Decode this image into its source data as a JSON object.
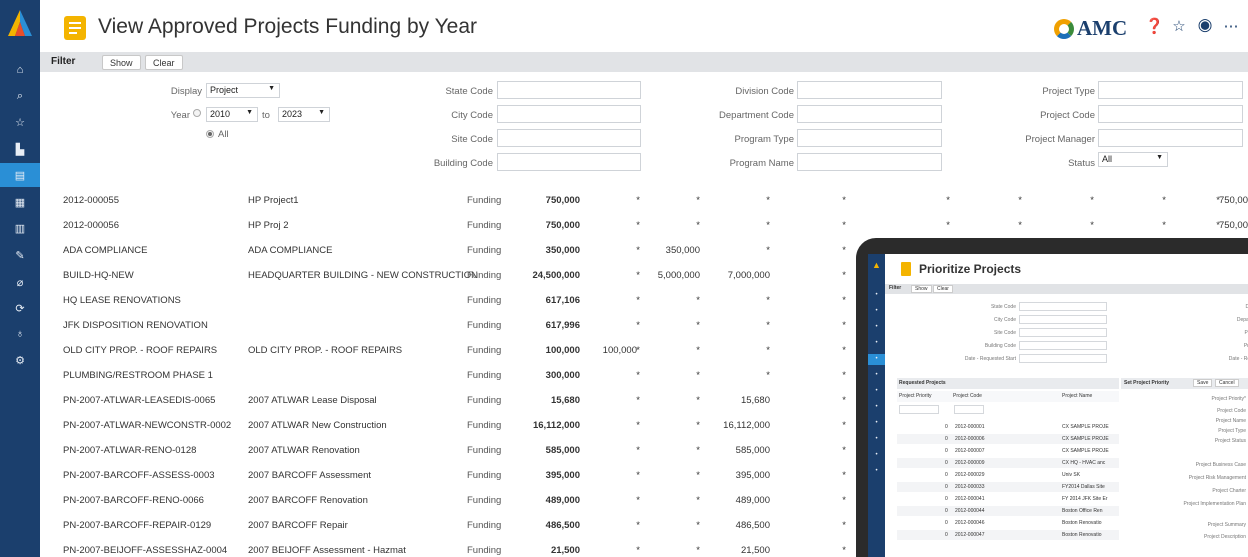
{
  "header": {
    "title": "View Approved Projects Funding by Year",
    "brand": "AMC"
  },
  "nav": {
    "rail_icons": [
      "home-icon",
      "search-icon",
      "star-icon",
      "building-chart-icon",
      "report-icon",
      "grid-icon",
      "document-icon",
      "wrench-icon",
      "tag-icon",
      "refresh-icon",
      "lightbulb-icon",
      "gear-icon"
    ],
    "active_index": 4
  },
  "filter_bar": {
    "label": "Filter",
    "show_label": "Show",
    "clear_label": "Clear"
  },
  "filters": {
    "display_label": "Display",
    "display_value": "Project",
    "year_label": "Year",
    "year_from": "2010",
    "to_label": "to",
    "year_to": "2023",
    "all_label": "All",
    "state_code": "State Code",
    "city_code": "City Code",
    "site_code": "Site Code",
    "building_code": "Building Code",
    "division_code": "Division Code",
    "department_code": "Department Code",
    "program_type": "Program Type",
    "program_name": "Program Name",
    "project_type": "Project Type",
    "project_code": "Project Code",
    "project_manager": "Project Manager",
    "status_label": "Status",
    "status_value": "All"
  },
  "rows": [
    {
      "code": "2012-000055",
      "name": "HP Project1",
      "type": "Funding",
      "total": "750,000",
      "y1": "*",
      "y2": "*",
      "y3": "*",
      "y4": "*",
      "y5": "*",
      "y6": "*",
      "y7": "*",
      "y8": "*",
      "y9": "*",
      "y10": "750,00"
    },
    {
      "code": "2012-000056",
      "name": "HP Proj 2",
      "type": "Funding",
      "total": "750,000",
      "y1": "*",
      "y2": "*",
      "y3": "*",
      "y4": "*",
      "y5": "*",
      "y6": "*",
      "y7": "*",
      "y8": "*",
      "y9": "*",
      "y10": "750,00"
    },
    {
      "code": "ADA COMPLIANCE",
      "name": "ADA COMPLIANCE",
      "type": "Funding",
      "total": "350,000",
      "y1": "*",
      "y2": "350,000",
      "y3": "*",
      "y4": "*"
    },
    {
      "code": "BUILD-HQ-NEW",
      "name": "HEADQUARTER BUILDING - NEW CONSTRUCTION",
      "type": "Funding",
      "total": "24,500,000",
      "y1": "*",
      "y2": "5,000,000",
      "y3": "7,000,000",
      "y4": "*"
    },
    {
      "code": "HQ LEASE RENOVATIONS",
      "name": "",
      "type": "Funding",
      "total": "617,106",
      "y1": "*",
      "y2": "*",
      "y3": "*",
      "y4": "*"
    },
    {
      "code": "JFK DISPOSITION RENOVATION",
      "name": "",
      "type": "Funding",
      "total": "617,996",
      "y1": "*",
      "y2": "*",
      "y3": "*",
      "y4": "*"
    },
    {
      "code": "OLD CITY PROP. - ROOF REPAIRS",
      "name": "OLD CITY PROP. - ROOF REPAIRS",
      "type": "Funding",
      "total": "100,000",
      "y0": "100,000",
      "y1": "*",
      "y2": "*",
      "y3": "*",
      "y4": "*"
    },
    {
      "code": "PLUMBING/RESTROOM PHASE 1",
      "name": "",
      "type": "Funding",
      "total": "300,000",
      "y1": "*",
      "y2": "*",
      "y3": "*",
      "y4": "*"
    },
    {
      "code": "PN-2007-ATLWAR-LEASEDIS-0065",
      "name": "2007 ATLWAR Lease Disposal",
      "type": "Funding",
      "total": "15,680",
      "y1": "*",
      "y2": "*",
      "y3": "15,680",
      "y4": "*"
    },
    {
      "code": "PN-2007-ATLWAR-NEWCONSTR-0002",
      "name": "2007 ATLWAR New Construction",
      "type": "Funding",
      "total": "16,112,000",
      "y1": "*",
      "y2": "*",
      "y3": "16,112,000",
      "y4": "*"
    },
    {
      "code": "PN-2007-ATLWAR-RENO-0128",
      "name": "2007 ATLWAR Renovation",
      "type": "Funding",
      "total": "585,000",
      "y1": "*",
      "y2": "*",
      "y3": "585,000",
      "y4": "*"
    },
    {
      "code": "PN-2007-BARCOFF-ASSESS-0003",
      "name": "2007 BARCOFF Assessment",
      "type": "Funding",
      "total": "395,000",
      "y1": "*",
      "y2": "*",
      "y3": "395,000",
      "y4": "*"
    },
    {
      "code": "PN-2007-BARCOFF-RENO-0066",
      "name": "2007 BARCOFF Renovation",
      "type": "Funding",
      "total": "489,000",
      "y1": "*",
      "y2": "*",
      "y3": "489,000",
      "y4": "*"
    },
    {
      "code": "PN-2007-BARCOFF-REPAIR-0129",
      "name": "2007 BARCOFF Repair",
      "type": "Funding",
      "total": "486,500",
      "y1": "*",
      "y2": "*",
      "y3": "486,500",
      "y4": "*"
    },
    {
      "code": "PN-2007-BEIJOFF-ASSESSHAZ-0004",
      "name": "2007 BEIJOFF Assessment - Hazmat",
      "type": "Funding",
      "total": "21,500",
      "y1": "*",
      "y2": "*",
      "y3": "21,500",
      "y4": "*"
    }
  ],
  "tablet": {
    "title": "Prioritize Projects",
    "filter_label": "Filter",
    "show_label": "Show",
    "clear_label": "Clear",
    "left_filters": [
      "State Code",
      "City Code",
      "Site Code",
      "Building Code",
      "Date - Requested Start"
    ],
    "right_filters": [
      "Division C",
      "Department C",
      "Program T",
      "Program N",
      "Date - Requested"
    ],
    "requested_header": "Requested Projects",
    "col_priority": "Project Priority",
    "col_code": "Project Code",
    "col_name": "Project Name",
    "set_priority": "Set Project Priority",
    "save": "Save",
    "cancel": "Cancel",
    "rows": [
      {
        "p": "0",
        "code": "2012-000001",
        "name": "CX SAMPLE PROJE"
      },
      {
        "p": "0",
        "code": "2012-000006",
        "name": "CX SAMPLE PROJE"
      },
      {
        "p": "0",
        "code": "2012-000007",
        "name": "CX SAMPLE PROJE"
      },
      {
        "p": "0",
        "code": "2012-000009",
        "name": "CX HQ - HVAC anc"
      },
      {
        "p": "0",
        "code": "2012-000029",
        "name": "Univ SK"
      },
      {
        "p": "0",
        "code": "2012-000033",
        "name": "FY2014 Dallas Site"
      },
      {
        "p": "0",
        "code": "2012-000041",
        "name": "FY 2014 JFK Site Er"
      },
      {
        "p": "0",
        "code": "2012-000044",
        "name": "Boston Office Ren"
      },
      {
        "p": "0",
        "code": "2012-000046",
        "name": "Boston Renovatio"
      },
      {
        "p": "0",
        "code": "2012-000047",
        "name": "Boston Renovatio"
      }
    ],
    "form_labels": [
      "Project Priority*",
      "Project Code",
      "Project Name",
      "Project Type",
      "Project Status",
      "Project Business Case",
      "Project Risk Management",
      "Project Charter",
      "Project Implementation Plan",
      "Project Summary",
      "Project Description"
    ]
  }
}
